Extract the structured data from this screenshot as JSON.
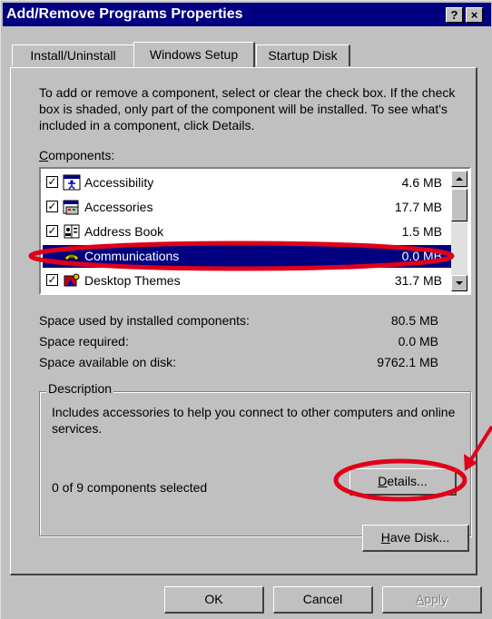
{
  "window": {
    "title": "Add/Remove Programs Properties",
    "help_glyph": "?",
    "close_glyph": "×"
  },
  "tabs": [
    {
      "label": "Install/Uninstall",
      "active": false
    },
    {
      "label": "Windows Setup",
      "active": true
    },
    {
      "label": "Startup Disk",
      "active": false
    }
  ],
  "instructions": "To add or remove a component, select or clear the check box. If the check box is shaded, only part of the component will be installed. To see what's included in a component, click Details.",
  "components_label": {
    "accel": "C",
    "rest": "omponents:"
  },
  "components": [
    {
      "name": "Accessibility",
      "size": "4.6 MB",
      "checked": true,
      "icon": "accessibility-icon",
      "selected": false
    },
    {
      "name": "Accessories",
      "size": "17.7 MB",
      "checked": true,
      "icon": "accessories-icon",
      "selected": false
    },
    {
      "name": "Address Book",
      "size": "1.5 MB",
      "checked": true,
      "icon": "address-book-icon",
      "selected": false
    },
    {
      "name": "Communications",
      "size": "0.0 MB",
      "checked": false,
      "icon": "communications-icon",
      "selected": true
    },
    {
      "name": "Desktop Themes",
      "size": "31.7 MB",
      "checked": true,
      "icon": "desktop-themes-icon",
      "selected": false
    }
  ],
  "space": [
    {
      "label": "Space used by installed components:",
      "value": "80.5 MB"
    },
    {
      "label": "Space required:",
      "value": "0.0 MB"
    },
    {
      "label": "Space available on disk:",
      "value": "9762.1 MB"
    }
  ],
  "description": {
    "group_label": "Description",
    "text": "Includes accessories to help you connect to other computers and online services.",
    "count_text": "0 of 9 components selected"
  },
  "buttons": {
    "details": {
      "accel": "D",
      "rest": "etails..."
    },
    "have_disk": {
      "accel": "H",
      "rest": "ave Disk..."
    },
    "ok": "OK",
    "cancel": "Cancel",
    "apply": {
      "accel": "A",
      "rest": "pply"
    }
  },
  "colors": {
    "selection": "#000080",
    "annotation": "#e0001a",
    "face": "#c0c0c0"
  }
}
